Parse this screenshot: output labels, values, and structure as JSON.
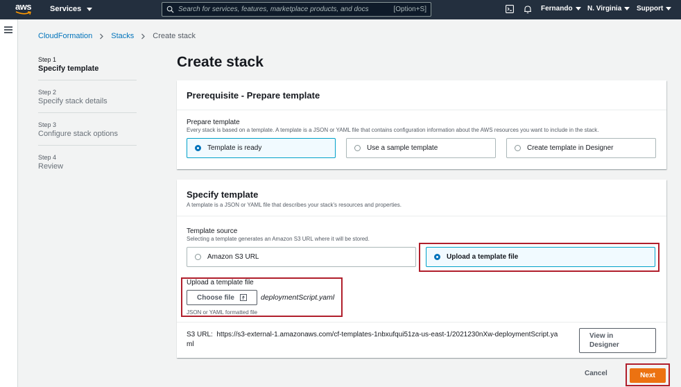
{
  "nav": {
    "logo_text": "aws",
    "services_label": "Services",
    "search_placeholder": "Search for services, features, marketplace products, and docs",
    "search_shortcut": "[Option+S]",
    "user": "Fernando",
    "region": "N. Virginia",
    "support": "Support"
  },
  "breadcrumb": {
    "items": [
      "CloudFormation",
      "Stacks",
      "Create stack"
    ]
  },
  "steps": [
    {
      "num": "Step 1",
      "title": "Specify template"
    },
    {
      "num": "Step 2",
      "title": "Specify stack details"
    },
    {
      "num": "Step 3",
      "title": "Configure stack options"
    },
    {
      "num": "Step 4",
      "title": "Review"
    }
  ],
  "page_title": "Create stack",
  "prerequisite": {
    "header": "Prerequisite - Prepare template",
    "label": "Prepare template",
    "description": "Every stack is based on a template. A template is a JSON or YAML file that contains configuration information about the AWS resources you want to include in the stack.",
    "options": [
      "Template is ready",
      "Use a sample template",
      "Create template in Designer"
    ]
  },
  "specify": {
    "header": "Specify template",
    "header_desc": "A template is a JSON or YAML file that describes your stack's resources and properties.",
    "source_label": "Template source",
    "source_desc": "Selecting a template generates an Amazon S3 URL where it will be stored.",
    "source_options": [
      "Amazon S3 URL",
      "Upload a template file"
    ],
    "upload_label": "Upload a template file",
    "choose_file": "Choose file",
    "file_name": "deploymentScript.yaml",
    "constraint": "JSON or YAML formatted file",
    "s3_label": "S3 URL:",
    "s3_url_line1": "https://s3-external-1.amazonaws.com/cf-templates-1nbxufqui51za-us-east-1/2021230nXw-deploymentScript.ya",
    "s3_url_line2": "ml",
    "view_designer_line1": "View in",
    "view_designer_line2": "Designer"
  },
  "footer": {
    "cancel": "Cancel",
    "next": "Next"
  },
  "colors": {
    "nav_bg": "#232f3e",
    "link": "#0073bb",
    "primary": "#ec7211",
    "highlight": "#b01e2b"
  }
}
